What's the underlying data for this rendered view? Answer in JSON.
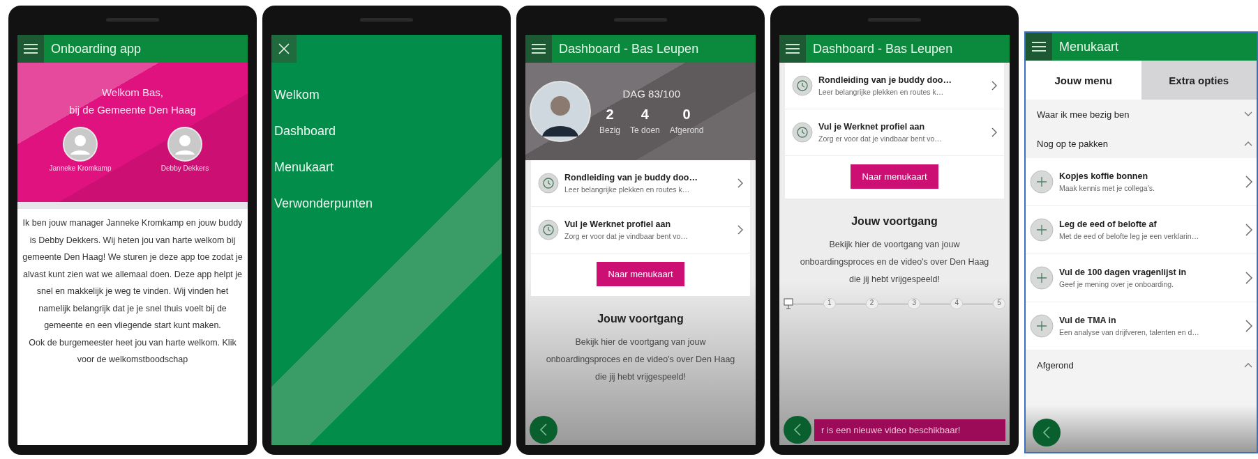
{
  "screens": [
    {
      "kind": "welcome",
      "header": {
        "title": "Onboarding app"
      },
      "greeting": [
        "Welkom Bas,",
        "bij de Gemeente Den Haag"
      ],
      "contacts": [
        {
          "name": "Janneke Kromkamp"
        },
        {
          "name": "Debby Dekkers"
        }
      ],
      "paragraphs": [
        "Ik ben jouw manager Janneke Kromkamp en jouw buddy is Debby Dekkers. Wij heten jou van harte welkom bij gemeente Den Haag! We sturen je deze app toe zodat je alvast kunt zien wat we allemaal doen. Deze app helpt je snel en makkelijk je weg te vinden. Wij vinden het namelijk belangrijk dat je je snel thuis voelt bij de gemeente en een vliegende start kunt maken.",
        "Ook de burgemeester heet jou van harte welkom. Klik voor de welkomstboodschap"
      ]
    },
    {
      "kind": "nav",
      "menu_items": [
        {
          "label": "Welkom"
        },
        {
          "label": "Dashboard"
        },
        {
          "label": "Menukaart"
        },
        {
          "label": "Verwonderpunten"
        }
      ]
    },
    {
      "kind": "dashboard",
      "header": {
        "title": "Dashboard - Bas Leupen"
      },
      "day": "DAG 83/100",
      "stats": [
        {
          "value": "2",
          "label": "Bezig"
        },
        {
          "value": "4",
          "label": "Te doen"
        },
        {
          "value": "0",
          "label": "Afgerond"
        }
      ],
      "tasks": [
        {
          "title": "Rondleiding van je buddy doo…",
          "subtitle": "Leer belangrijke plekken en routes k…"
        },
        {
          "title": "Vul je Werknet profiel aan",
          "subtitle": "Zorg er voor dat je vindbaar bent vo…"
        }
      ],
      "button": "Naar menukaart",
      "progress": {
        "title": "Jouw voortgang",
        "text": "Bekijk hier de voortgang van jouw onboardingsproces en de video's over Den Haag die jij hebt vrijgespeeld!"
      }
    },
    {
      "kind": "progress",
      "header": {
        "title": "Dashboard - Bas Leupen"
      },
      "tasks": [
        {
          "title": "Rondleiding van je buddy doo…",
          "subtitle": "Leer belangrijke plekken en routes k…"
        },
        {
          "title": "Vul je Werknet profiel aan",
          "subtitle": "Zorg er voor dat je vindbaar bent vo…"
        }
      ],
      "button": "Naar menukaart",
      "progress": {
        "title": "Jouw voortgang",
        "text": "Bekijk hier de voortgang van jouw onboardingsproces en de video's over Den Haag die jij hebt vrijgespeeld!"
      },
      "steps": [
        "1",
        "2",
        "3",
        "4",
        "5"
      ],
      "banner": "r is een nieuwe video beschikbaar!"
    },
    {
      "kind": "menukaart",
      "header": {
        "title": "Menukaart"
      },
      "tabs": [
        {
          "label": "Jouw menu",
          "selected": true
        },
        {
          "label": "Extra opties",
          "selected": false
        }
      ],
      "sections": [
        {
          "title": "Waar ik mee bezig ben",
          "expanded": false
        },
        {
          "title": "Nog op te pakken",
          "expanded": true,
          "items": [
            {
              "title": "Kopjes koffie bonnen",
              "subtitle": "Maak kennis met je collega's."
            },
            {
              "title": "Leg de eed of belofte af",
              "subtitle": "Met de eed of belofte leg je een verklarin…"
            },
            {
              "title": "Vul de 100 dagen vragenlijst in",
              "subtitle": "Geef je mening over je onboarding."
            },
            {
              "title": "Vul de TMA in",
              "subtitle": "Een analyse van drijfveren, talenten en d…"
            }
          ]
        },
        {
          "title": "Afgerond",
          "expanded": true
        }
      ]
    }
  ]
}
